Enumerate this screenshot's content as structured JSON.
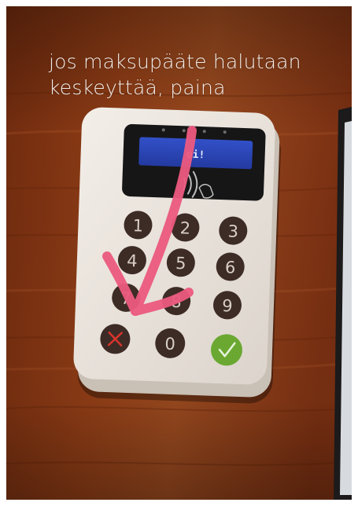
{
  "caption": {
    "line1": "jos maksupääte halutaan",
    "line2": "keskeyttää, paina"
  },
  "terminal": {
    "screen_text": "oi!",
    "keys": [
      "1",
      "2",
      "3",
      "4",
      "5",
      "6",
      "7",
      "8",
      "9",
      "0"
    ],
    "cancel_symbol": "✕",
    "confirm_symbol": "✓"
  },
  "colors": {
    "table_wood": "#8a3a16",
    "terminal_body": "#ece6df",
    "key": "#3d2b26",
    "key_text": "#d8cfc8",
    "screen": "#2b45b8",
    "confirm": "#6aa832",
    "cancel_mark": "#d8352c",
    "arrow": "#ec5a7f"
  },
  "icons": [
    "contactless-icon",
    "cancel-icon",
    "confirm-icon",
    "arrow-annotation"
  ]
}
